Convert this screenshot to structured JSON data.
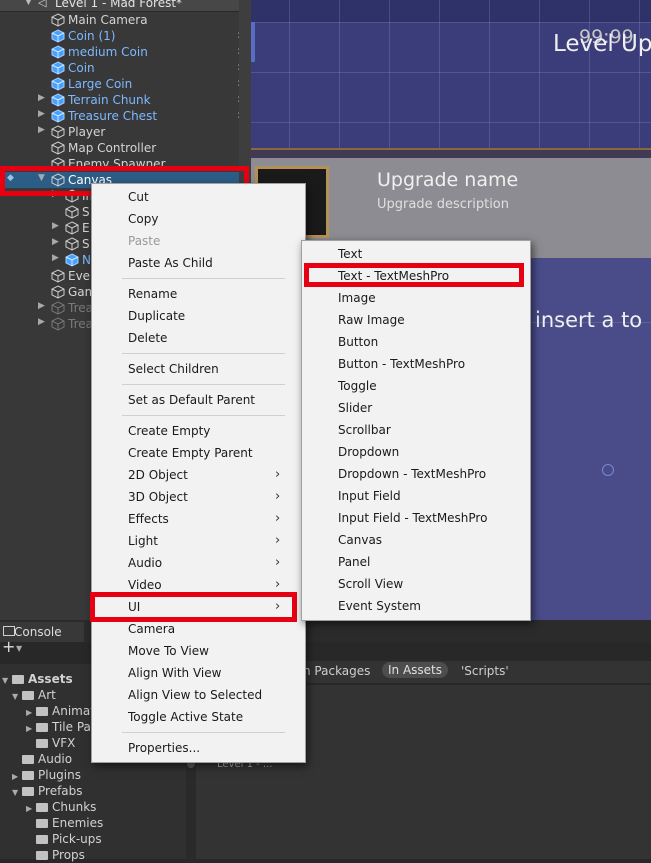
{
  "scene": {
    "title": "Level 1 - Mad Forest*"
  },
  "hierarchy": [
    {
      "name": "Main Camera",
      "color": "white",
      "chev": false,
      "arrow": ""
    },
    {
      "name": "Coin (1)",
      "color": "blue",
      "chev": true,
      "arrow": ""
    },
    {
      "name": "medium Coin",
      "color": "blue",
      "chev": true,
      "arrow": ""
    },
    {
      "name": "Coin",
      "color": "blue",
      "chev": true,
      "arrow": ""
    },
    {
      "name": "Large Coin",
      "color": "blue",
      "chev": true,
      "arrow": ""
    },
    {
      "name": "Terrain Chunk",
      "color": "blue",
      "chev": true,
      "arrow": "▶"
    },
    {
      "name": "Treasure Chest",
      "color": "blue",
      "chev": true,
      "arrow": "▶"
    },
    {
      "name": "Player",
      "color": "white",
      "chev": false,
      "arrow": "▶"
    },
    {
      "name": "Map Controller",
      "color": "white",
      "chev": false,
      "arrow": ""
    },
    {
      "name": "Enemy Spawner",
      "color": "white",
      "chev": false,
      "arrow": ""
    },
    {
      "name": "Canvas",
      "color": "white",
      "chev": false,
      "arrow": "▼",
      "selected": true
    },
    {
      "name": "Im",
      "color": "white",
      "chev": false,
      "arrow": "▶",
      "indent": true
    },
    {
      "name": "S",
      "color": "white",
      "chev": false,
      "arrow": "",
      "indent": true
    },
    {
      "name": "E",
      "color": "white",
      "chev": false,
      "arrow": "▶",
      "indent": true
    },
    {
      "name": "S",
      "color": "white",
      "chev": false,
      "arrow": "▶",
      "indent": true
    },
    {
      "name": "N",
      "color": "blue",
      "chev": false,
      "arrow": "▶",
      "indent": true
    },
    {
      "name": "Eve",
      "color": "white",
      "chev": false,
      "arrow": ""
    },
    {
      "name": "Gam",
      "color": "white",
      "chev": false,
      "arrow": ""
    },
    {
      "name": "Trea",
      "color": "grey",
      "chev": false,
      "arrow": "▶"
    },
    {
      "name": "Trea",
      "color": "grey",
      "chev": false,
      "arrow": "▶"
    }
  ],
  "game": {
    "timer": "99:99",
    "title": "Level Up",
    "upgrade_name": "Upgrade name",
    "upgrade_desc": "Upgrade description",
    "insert_text": "n insert a to"
  },
  "context_menu": {
    "items": [
      {
        "label": "Cut"
      },
      {
        "label": "Copy"
      },
      {
        "label": "Paste",
        "disabled": true
      },
      {
        "label": "Paste As Child"
      },
      {
        "sep": true
      },
      {
        "label": "Rename"
      },
      {
        "label": "Duplicate"
      },
      {
        "label": "Delete"
      },
      {
        "sep": true
      },
      {
        "label": "Select Children"
      },
      {
        "sep": true
      },
      {
        "label": "Set as Default Parent"
      },
      {
        "sep": true
      },
      {
        "label": "Create Empty"
      },
      {
        "label": "Create Empty Parent"
      },
      {
        "label": "2D Object",
        "sub": true
      },
      {
        "label": "3D Object",
        "sub": true
      },
      {
        "label": "Effects",
        "sub": true
      },
      {
        "label": "Light",
        "sub": true
      },
      {
        "label": "Audio",
        "sub": true
      },
      {
        "label": "Video",
        "sub": true
      },
      {
        "label": "UI",
        "sub": true,
        "highlight": true
      },
      {
        "label": "Camera"
      },
      {
        "label": "Move To View"
      },
      {
        "label": "Align With View"
      },
      {
        "label": "Align View to Selected"
      },
      {
        "label": "Toggle Active State"
      },
      {
        "sep": true
      },
      {
        "label": "Properties..."
      }
    ]
  },
  "ui_submenu": {
    "items": [
      {
        "label": "Text"
      },
      {
        "label": "Text - TextMeshPro",
        "highlight": true
      },
      {
        "label": "Image"
      },
      {
        "label": "Raw Image"
      },
      {
        "label": "Button"
      },
      {
        "label": "Button - TextMeshPro"
      },
      {
        "label": "Toggle"
      },
      {
        "label": "Slider"
      },
      {
        "label": "Scrollbar"
      },
      {
        "label": "Dropdown"
      },
      {
        "label": "Dropdown - TextMeshPro"
      },
      {
        "label": "Input Field"
      },
      {
        "label": "Input Field - TextMeshPro"
      },
      {
        "label": "Canvas"
      },
      {
        "label": "Panel"
      },
      {
        "label": "Scroll View"
      },
      {
        "label": "Event System"
      }
    ]
  },
  "bottom": {
    "console_tab": "Console",
    "plus": "+",
    "filters": [
      "n Packages",
      "In Assets",
      "'Scripts'"
    ],
    "search_result": "Level 1 - ...",
    "assets_root": "Assets",
    "tree": [
      {
        "name": "Art",
        "arrow": "▼"
      },
      {
        "name": "Animat",
        "arrow": "▶",
        "indent": 1
      },
      {
        "name": "Tile Pa",
        "arrow": "▶",
        "indent": 1
      },
      {
        "name": "VFX",
        "arrow": "",
        "indent": 1
      },
      {
        "name": "Audio",
        "arrow": ""
      },
      {
        "name": "Plugins",
        "arrow": "▶"
      },
      {
        "name": "Prefabs",
        "arrow": "▼"
      },
      {
        "name": "Chunks",
        "arrow": "▶",
        "indent": 1
      },
      {
        "name": "Enemies",
        "arrow": "",
        "indent": 1
      },
      {
        "name": "Pick-ups",
        "arrow": "",
        "indent": 1
      },
      {
        "name": "Props",
        "arrow": "",
        "indent": 1
      }
    ]
  }
}
